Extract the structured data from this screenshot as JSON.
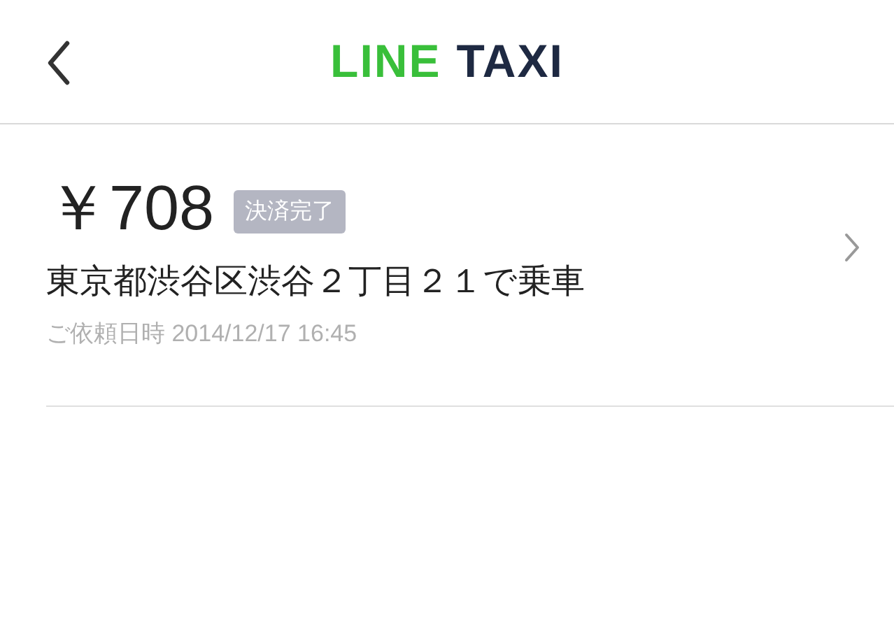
{
  "header": {
    "logo": [
      {
        "text": "LINE",
        "color": "#39bf3a"
      },
      {
        "text": "TAXI",
        "color": "#1e2942"
      }
    ]
  },
  "rides": [
    {
      "price": "￥708",
      "status": "決済完了",
      "pickup": "東京都渋谷区渋谷２丁目２１で乗車",
      "requested": "ご依頼日時 2014/12/17 16:45"
    }
  ]
}
